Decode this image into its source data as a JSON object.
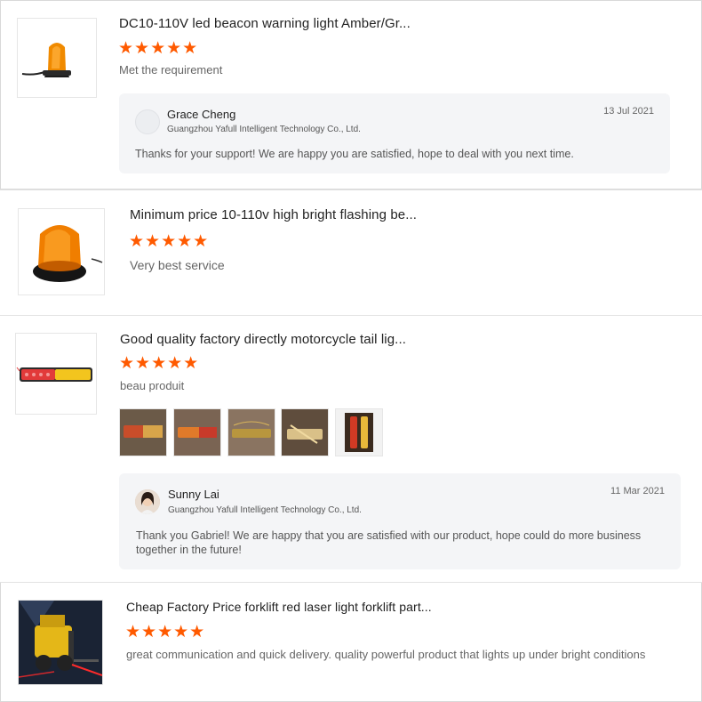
{
  "reviews": [
    {
      "title": "DC10-110V led beacon warning light Amber/Gr...",
      "stars": "★★★★★",
      "rating": 5,
      "comment": "Met the requirement",
      "reply": {
        "name": "Grace Cheng",
        "company": "Guangzhou Yafull Intelligent Technology Co., Ltd.",
        "date": "13 Jul 2021",
        "message": "Thanks for your support! We are happy you are satisfied, hope to deal with you next time."
      }
    },
    {
      "title": "Minimum price 10-110v high bright flashing be...",
      "stars": "★★★★★",
      "rating": 5,
      "comment": "Very best service"
    },
    {
      "title": "Good quality factory directly motorcycle tail lig...",
      "stars": "★★★★★",
      "rating": 5,
      "comment": "beau produit",
      "reply": {
        "name": "Sunny Lai",
        "company": "Guangzhou Yafull Intelligent Technology Co., Ltd.",
        "date": "11 Mar 2021",
        "message_line1": "Thank you Gabriel! We are happy that you are satisfied with our product, hope could do more business",
        "message_line2": "together in the future!"
      }
    },
    {
      "title": "Cheap Factory Price forklift red laser light forklift part...",
      "stars": "★★★★★",
      "rating": 5,
      "comment": "great communication and quick delivery. quality powerful product that lights up under bright conditions"
    }
  ],
  "colors": {
    "star": "#ff5a00",
    "reply_bg": "#f4f5f7"
  }
}
